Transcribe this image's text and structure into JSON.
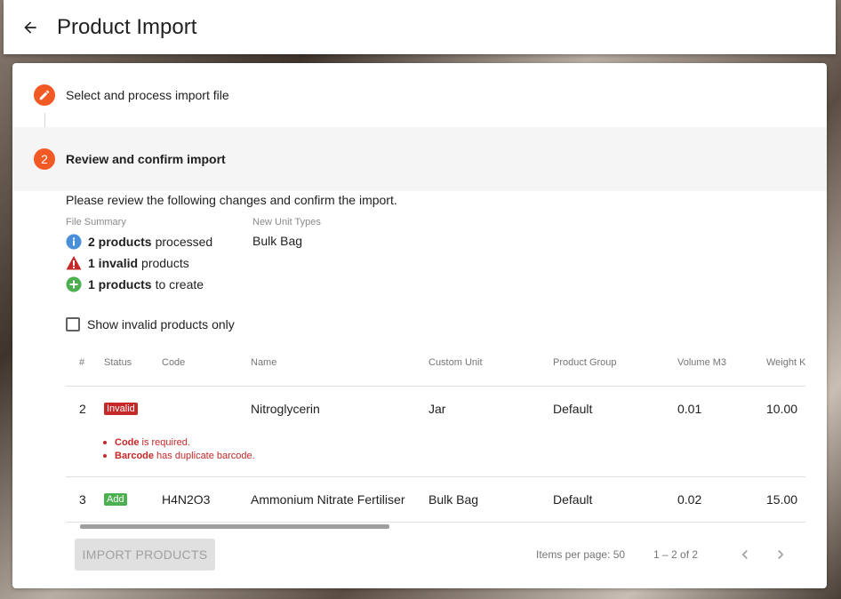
{
  "header": {
    "back_icon": "arrow-left-icon",
    "title": "Product Import"
  },
  "stepper": {
    "steps": [
      {
        "icon": "pencil-icon",
        "label": "Select and process import file"
      },
      {
        "number": "2",
        "label": "Review and confirm import"
      }
    ]
  },
  "review": {
    "intro": "Please review the following changes and confirm the import.",
    "file_summary_label": "File Summary",
    "summary": [
      {
        "icon": "info-icon",
        "color": "#4a90d9",
        "count": "2 products",
        "text": "processed"
      },
      {
        "icon": "warning-icon",
        "color": "#c62828",
        "count": "1 invalid",
        "text": "products"
      },
      {
        "icon": "add-circle-icon",
        "color": "#4caf50",
        "count": "1 products",
        "text": "to create"
      }
    ],
    "new_unit_types_label": "New Unit Types",
    "new_unit_types": "Bulk Bag",
    "show_invalid_label": "Show invalid products only"
  },
  "table": {
    "columns": [
      "#",
      "Status",
      "Code",
      "Name",
      "Custom Unit",
      "Product Group",
      "Volume M3",
      "Weight K"
    ],
    "rows": [
      {
        "num": "2",
        "status": "Invalid",
        "code": "",
        "name": "Nitroglycerin",
        "unit": "Jar",
        "group": "Default",
        "volume": "0.01",
        "weight": "10.00",
        "errors": [
          {
            "field": "Code",
            "message": "is required."
          },
          {
            "field": "Barcode",
            "message": "has duplicate barcode."
          }
        ]
      },
      {
        "num": "3",
        "status": "Add",
        "code": "H4N2O3",
        "name": "Ammonium Nitrate Fertiliser",
        "unit": "Bulk Bag",
        "group": "Default",
        "volume": "0.02",
        "weight": "15.00"
      }
    ]
  },
  "footer": {
    "import_label": "IMPORT PRODUCTS",
    "items_per_page": "Items per page: 50",
    "range": "1 – 2 of 2",
    "prev_icon": "chevron-left-icon",
    "next_icon": "chevron-right-icon"
  },
  "colors": {
    "accent": "#f15a24",
    "invalid": "#c62828",
    "add": "#4caf50"
  }
}
